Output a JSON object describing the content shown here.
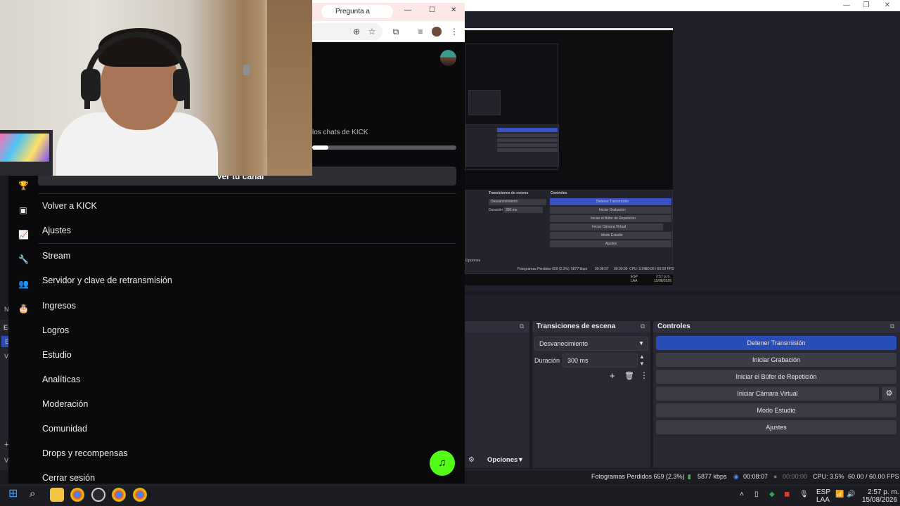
{
  "browser": {
    "gemini_button": "Pregunta a Gemini",
    "window_controls": {
      "minimize": "—",
      "maximize": "☐",
      "close": "✕"
    }
  },
  "kick": {
    "chats_text": "los chats de KICK",
    "progress_value_pct": 11,
    "channel_button": "Ver tu canal",
    "menu": [
      "Volver a KICK",
      "Ajustes",
      "Stream",
      "Servidor y clave de retransmisión",
      "Ingresos",
      "Logros",
      "Estudio",
      "Analíticas",
      "Moderación",
      "Comunidad",
      "Drops y recompensas",
      "Cerrar sesión"
    ],
    "sidebar_icons": [
      "trophy-icon",
      "video-icon",
      "chart-icon",
      "wrench-icon",
      "people-icon",
      "cake-icon"
    ],
    "accent": "#53fc18"
  },
  "obs": {
    "transitions": {
      "title": "Transiciones de escena",
      "selected": "Desvanecimiento",
      "duration_label": "Duración",
      "duration_value": "300 ms"
    },
    "controls": {
      "title": "Controles",
      "buttons": [
        "Detener Transmisión",
        "Iniciar Grabación",
        "Iniciar el Búfer de Repetición",
        "Iniciar Cámara Virtual",
        "Modo Estudio",
        "Ajustes"
      ]
    },
    "sources_footer": {
      "options": "Opciones"
    },
    "status": {
      "dropped": "Fotogramas Perdidos 659 (2.3%)",
      "bitrate": "5877 kbps",
      "stream_time": "00:08:07",
      "rec_time": "00:00:00",
      "cpu": "CPU: 3.5%",
      "fps": "60.00 / 60.00 FPS"
    },
    "left_fragments": [
      "N",
      "Es",
      "E",
      "V",
      "+",
      "V"
    ],
    "mini_preview": {
      "controls_title": "Controles",
      "transitions_title": "Transiciones de escena",
      "selected": "Desvanecimiento",
      "duration_label": "Duración",
      "duration_value": "300 ms",
      "buttons": [
        "Detener Transmisión",
        "Iniciar Grabación",
        "Iniciar el Búfer de Repetición",
        "Iniciar Cámara Virtual",
        "Modo Estudio",
        "Ajustes"
      ],
      "options": "Opciones",
      "status": "Fotogramas Perdidos 659 (2.3%)",
      "bitrate": "5877 kbps",
      "stream_time": "00:08:07",
      "rec_time": "00:00:00",
      "cpu": "CPU: 3.5%",
      "fps": "60.00 / 60.00 FPS",
      "lang": "ESP",
      "lang2": "LAA",
      "time": "2:57 p.m.",
      "date": "15/08/2026"
    },
    "accent": "#284cb8"
  },
  "taskbar": {
    "lang": "ESP",
    "lang2": "LAA",
    "time": "2:57 p. m.",
    "date": "15/08/2026"
  }
}
